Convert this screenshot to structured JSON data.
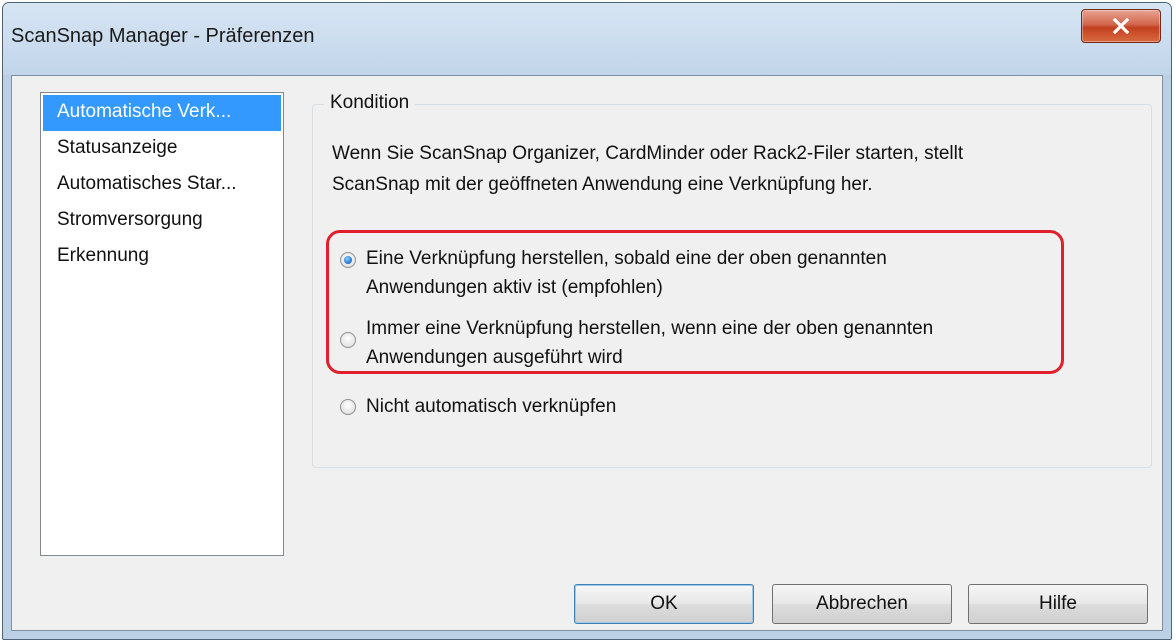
{
  "window": {
    "title": "ScanSnap Manager - Präferenzen"
  },
  "sidebar": {
    "items": [
      {
        "label": "Automatische Verk...",
        "selected": true
      },
      {
        "label": "Statusanzeige",
        "selected": false
      },
      {
        "label": "Automatisches Star...",
        "selected": false
      },
      {
        "label": "Stromversorgung",
        "selected": false
      },
      {
        "label": "Erkennung",
        "selected": false
      }
    ]
  },
  "group": {
    "title": "Kondition",
    "description_line1": "Wenn Sie ScanSnap Organizer, CardMinder oder Rack2-Filer starten, stellt",
    "description_line2": "ScanSnap mit der geöffneten Anwendung eine Verknüpfung her.",
    "options": [
      {
        "line1": "Eine Verknüpfung herstellen, sobald eine der oben genannten",
        "line2": "Anwendungen aktiv ist (empfohlen)",
        "checked": true
      },
      {
        "line1": "Immer eine Verknüpfung herstellen, wenn eine der oben genannten",
        "line2": "Anwendungen ausgeführt wird",
        "checked": false
      },
      {
        "line1": "Nicht automatisch verknüpfen",
        "line2": "",
        "checked": false
      }
    ]
  },
  "buttons": {
    "ok": "OK",
    "cancel": "Abbrechen",
    "help": "Hilfe"
  },
  "icons": {
    "close": "close-icon"
  },
  "colors": {
    "selection": "#3399ff",
    "highlight_outline": "#e0202d",
    "close_button": "#c3401f"
  }
}
